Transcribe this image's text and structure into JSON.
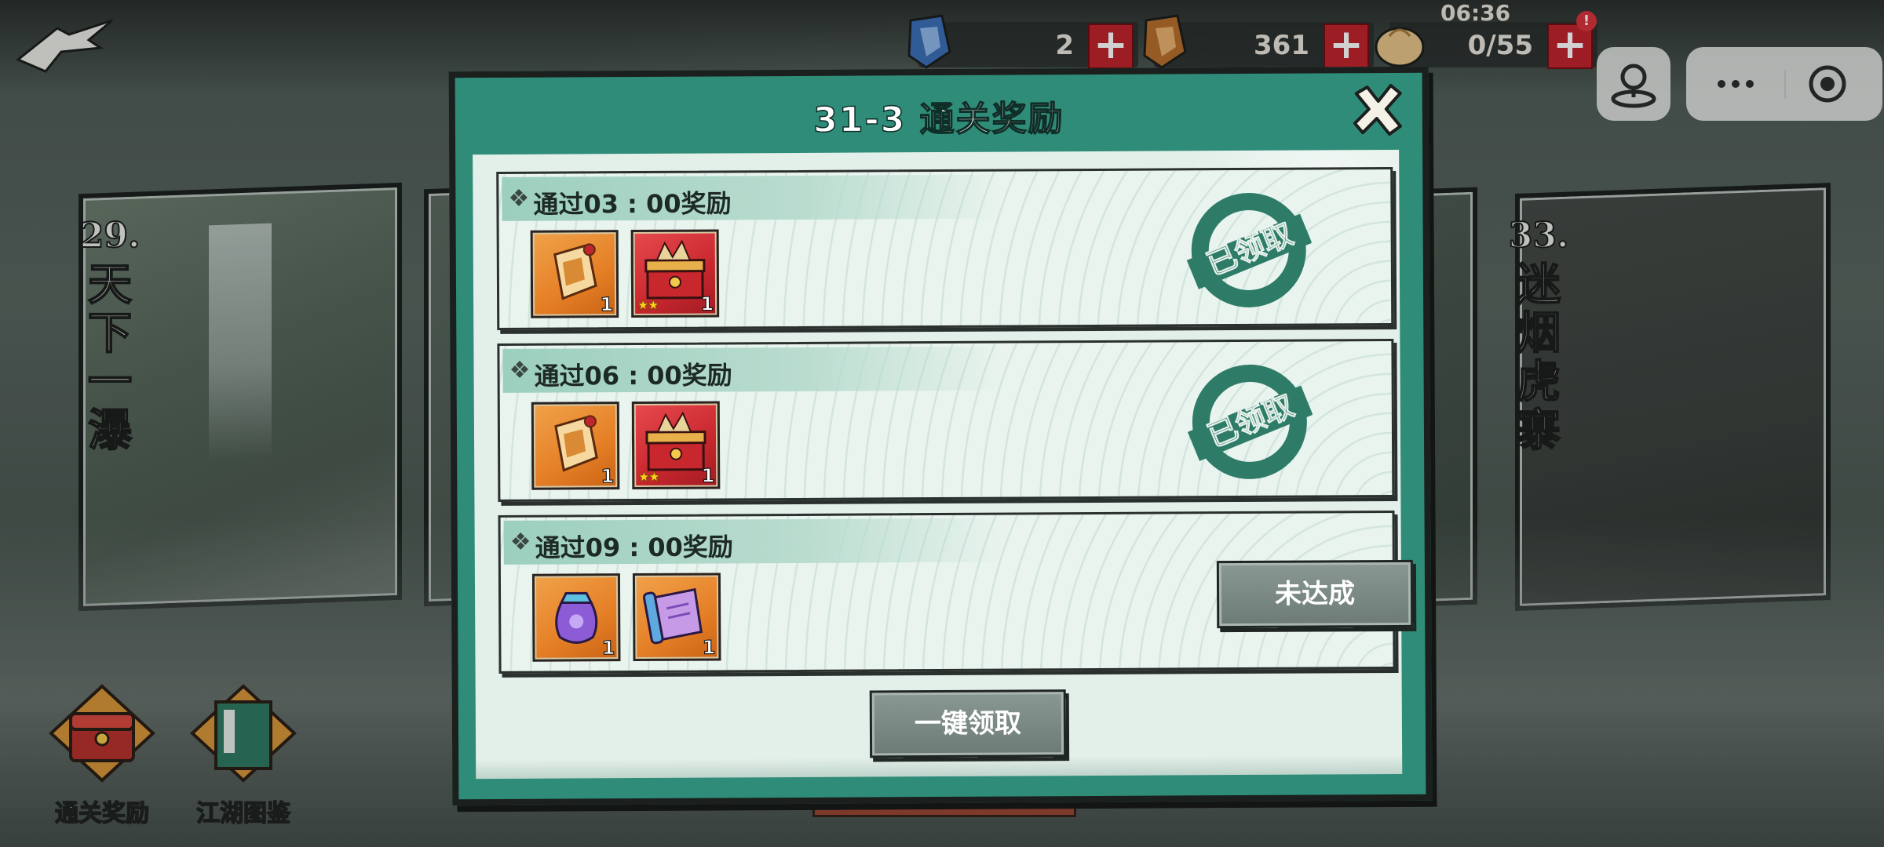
{
  "hud": {
    "time": "06:36",
    "currency1": {
      "value": "2",
      "icon": "blue-token-icon"
    },
    "currency2": {
      "value": "361",
      "icon": "bronze-token-icon"
    },
    "stamina": {
      "value": "0/55",
      "icon": "bun-icon"
    },
    "alert_badge": "!",
    "plus_label": "+"
  },
  "stages": {
    "left": {
      "number": "29.",
      "name": "天下一瀑"
    },
    "right": {
      "number": "33.",
      "name": "迷烟虎寨"
    }
  },
  "side_buttons": [
    {
      "label": "通关奖励",
      "icon": "treasure-chest-icon"
    },
    {
      "label": "江湖图鉴",
      "icon": "book-icon"
    }
  ],
  "dialog": {
    "title": "31-3 通关奖励",
    "rows": [
      {
        "title": "通过03 : 00奖励",
        "items": [
          {
            "kind": "orange",
            "icon": "token-scroll-icon",
            "count": "1",
            "stars": ""
          },
          {
            "kind": "red",
            "icon": "treasure-box-icon",
            "count": "1",
            "stars": "★★"
          }
        ],
        "status": "已领取"
      },
      {
        "title": "通过06 : 00奖励",
        "items": [
          {
            "kind": "orange",
            "icon": "token-scroll-icon",
            "count": "1",
            "stars": ""
          },
          {
            "kind": "red",
            "icon": "treasure-box-icon",
            "count": "1",
            "stars": "★★"
          }
        ],
        "status": "已领取"
      },
      {
        "title": "通过09 : 00奖励",
        "items": [
          {
            "kind": "orange",
            "icon": "purple-pouch-icon",
            "count": "1",
            "stars": ""
          },
          {
            "kind": "orange",
            "icon": "purple-scroll-icon",
            "count": "1",
            "stars": ""
          }
        ],
        "status": "未达成"
      }
    ],
    "claim_all_label": "一键领取"
  },
  "colors": {
    "dialog_frame": "#2f8c78",
    "panel": "#e3efe9",
    "stamp": "#2e7c68",
    "plus_button": "#c0242d"
  }
}
